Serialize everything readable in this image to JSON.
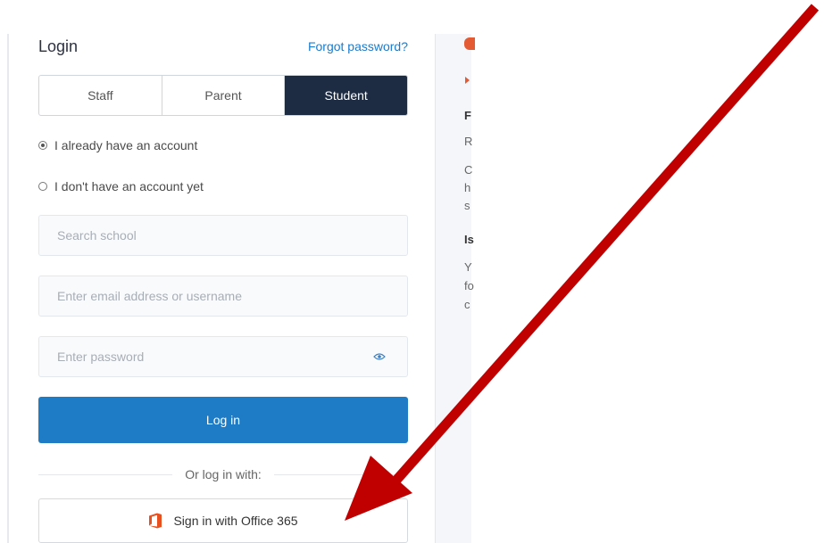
{
  "login": {
    "title": "Login",
    "forgot_password": "Forgot password?",
    "tabs": [
      {
        "label": "Staff",
        "active": false
      },
      {
        "label": "Parent",
        "active": false
      },
      {
        "label": "Student",
        "active": true
      }
    ],
    "radio_options": [
      {
        "label": "I already have an account",
        "checked": true
      },
      {
        "label": "I don't have an account yet",
        "checked": false
      }
    ],
    "school_input": {
      "placeholder": "Search school",
      "value": ""
    },
    "email_input": {
      "placeholder": "Enter email address or username",
      "value": ""
    },
    "password_input": {
      "placeholder": "Enter password",
      "value": ""
    },
    "login_button": "Log in",
    "divider_text": "Or log in with:",
    "office_button": "Sign in with Office 365"
  },
  "info_panel": {
    "fragments": [
      "F",
      "R",
      "C",
      "h",
      "s",
      "Is",
      "Y",
      "fo",
      "c"
    ]
  },
  "colors": {
    "accent": "#1e7bc6",
    "active_tab": "#1e2c43",
    "link": "#1c7bcc",
    "arrow": "#c00000",
    "office_orange": "#e8501f"
  },
  "icons": {
    "password_toggle": "eye-icon",
    "office": "office-365-icon",
    "annotation": "red-arrow"
  }
}
